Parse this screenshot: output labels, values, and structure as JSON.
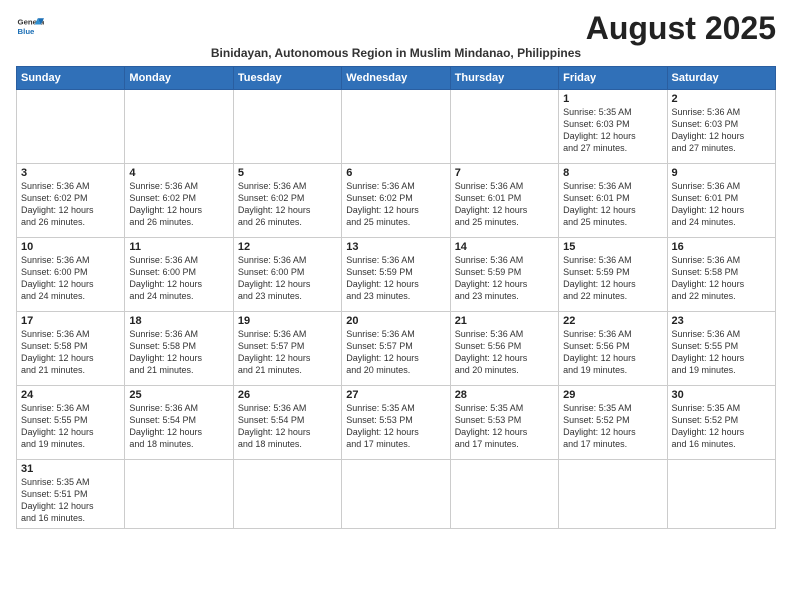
{
  "header": {
    "logo_general": "General",
    "logo_blue": "Blue",
    "month_title": "August 2025",
    "subtitle": "Binidayan, Autonomous Region in Muslim Mindanao, Philippines"
  },
  "days_of_week": [
    "Sunday",
    "Monday",
    "Tuesday",
    "Wednesday",
    "Thursday",
    "Friday",
    "Saturday"
  ],
  "weeks": [
    [
      {
        "day": "",
        "info": ""
      },
      {
        "day": "",
        "info": ""
      },
      {
        "day": "",
        "info": ""
      },
      {
        "day": "",
        "info": ""
      },
      {
        "day": "",
        "info": ""
      },
      {
        "day": "1",
        "info": "Sunrise: 5:35 AM\nSunset: 6:03 PM\nDaylight: 12 hours\nand 27 minutes."
      },
      {
        "day": "2",
        "info": "Sunrise: 5:36 AM\nSunset: 6:03 PM\nDaylight: 12 hours\nand 27 minutes."
      }
    ],
    [
      {
        "day": "3",
        "info": "Sunrise: 5:36 AM\nSunset: 6:02 PM\nDaylight: 12 hours\nand 26 minutes."
      },
      {
        "day": "4",
        "info": "Sunrise: 5:36 AM\nSunset: 6:02 PM\nDaylight: 12 hours\nand 26 minutes."
      },
      {
        "day": "5",
        "info": "Sunrise: 5:36 AM\nSunset: 6:02 PM\nDaylight: 12 hours\nand 26 minutes."
      },
      {
        "day": "6",
        "info": "Sunrise: 5:36 AM\nSunset: 6:02 PM\nDaylight: 12 hours\nand 25 minutes."
      },
      {
        "day": "7",
        "info": "Sunrise: 5:36 AM\nSunset: 6:01 PM\nDaylight: 12 hours\nand 25 minutes."
      },
      {
        "day": "8",
        "info": "Sunrise: 5:36 AM\nSunset: 6:01 PM\nDaylight: 12 hours\nand 25 minutes."
      },
      {
        "day": "9",
        "info": "Sunrise: 5:36 AM\nSunset: 6:01 PM\nDaylight: 12 hours\nand 24 minutes."
      }
    ],
    [
      {
        "day": "10",
        "info": "Sunrise: 5:36 AM\nSunset: 6:00 PM\nDaylight: 12 hours\nand 24 minutes."
      },
      {
        "day": "11",
        "info": "Sunrise: 5:36 AM\nSunset: 6:00 PM\nDaylight: 12 hours\nand 24 minutes."
      },
      {
        "day": "12",
        "info": "Sunrise: 5:36 AM\nSunset: 6:00 PM\nDaylight: 12 hours\nand 23 minutes."
      },
      {
        "day": "13",
        "info": "Sunrise: 5:36 AM\nSunset: 5:59 PM\nDaylight: 12 hours\nand 23 minutes."
      },
      {
        "day": "14",
        "info": "Sunrise: 5:36 AM\nSunset: 5:59 PM\nDaylight: 12 hours\nand 23 minutes."
      },
      {
        "day": "15",
        "info": "Sunrise: 5:36 AM\nSunset: 5:59 PM\nDaylight: 12 hours\nand 22 minutes."
      },
      {
        "day": "16",
        "info": "Sunrise: 5:36 AM\nSunset: 5:58 PM\nDaylight: 12 hours\nand 22 minutes."
      }
    ],
    [
      {
        "day": "17",
        "info": "Sunrise: 5:36 AM\nSunset: 5:58 PM\nDaylight: 12 hours\nand 21 minutes."
      },
      {
        "day": "18",
        "info": "Sunrise: 5:36 AM\nSunset: 5:58 PM\nDaylight: 12 hours\nand 21 minutes."
      },
      {
        "day": "19",
        "info": "Sunrise: 5:36 AM\nSunset: 5:57 PM\nDaylight: 12 hours\nand 21 minutes."
      },
      {
        "day": "20",
        "info": "Sunrise: 5:36 AM\nSunset: 5:57 PM\nDaylight: 12 hours\nand 20 minutes."
      },
      {
        "day": "21",
        "info": "Sunrise: 5:36 AM\nSunset: 5:56 PM\nDaylight: 12 hours\nand 20 minutes."
      },
      {
        "day": "22",
        "info": "Sunrise: 5:36 AM\nSunset: 5:56 PM\nDaylight: 12 hours\nand 19 minutes."
      },
      {
        "day": "23",
        "info": "Sunrise: 5:36 AM\nSunset: 5:55 PM\nDaylight: 12 hours\nand 19 minutes."
      }
    ],
    [
      {
        "day": "24",
        "info": "Sunrise: 5:36 AM\nSunset: 5:55 PM\nDaylight: 12 hours\nand 19 minutes."
      },
      {
        "day": "25",
        "info": "Sunrise: 5:36 AM\nSunset: 5:54 PM\nDaylight: 12 hours\nand 18 minutes."
      },
      {
        "day": "26",
        "info": "Sunrise: 5:36 AM\nSunset: 5:54 PM\nDaylight: 12 hours\nand 18 minutes."
      },
      {
        "day": "27",
        "info": "Sunrise: 5:35 AM\nSunset: 5:53 PM\nDaylight: 12 hours\nand 17 minutes."
      },
      {
        "day": "28",
        "info": "Sunrise: 5:35 AM\nSunset: 5:53 PM\nDaylight: 12 hours\nand 17 minutes."
      },
      {
        "day": "29",
        "info": "Sunrise: 5:35 AM\nSunset: 5:52 PM\nDaylight: 12 hours\nand 17 minutes."
      },
      {
        "day": "30",
        "info": "Sunrise: 5:35 AM\nSunset: 5:52 PM\nDaylight: 12 hours\nand 16 minutes."
      }
    ],
    [
      {
        "day": "31",
        "info": "Sunrise: 5:35 AM\nSunset: 5:51 PM\nDaylight: 12 hours\nand 16 minutes."
      },
      {
        "day": "",
        "info": ""
      },
      {
        "day": "",
        "info": ""
      },
      {
        "day": "",
        "info": ""
      },
      {
        "day": "",
        "info": ""
      },
      {
        "day": "",
        "info": ""
      },
      {
        "day": "",
        "info": ""
      }
    ]
  ]
}
